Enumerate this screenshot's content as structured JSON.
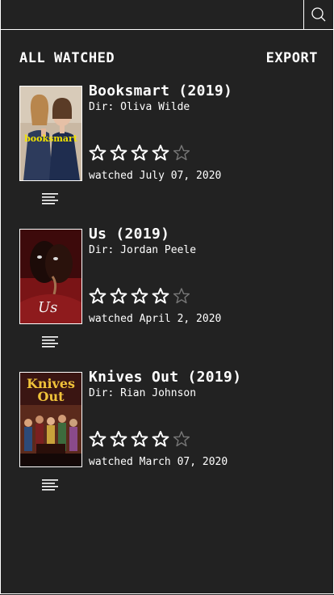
{
  "search": {
    "value": "",
    "placeholder": ""
  },
  "header": {
    "title": "ALL WATCHED",
    "export_label": "EXPORT"
  },
  "colors": {
    "background": "#222222",
    "foreground": "#ffffff",
    "star_empty": "#777777"
  },
  "movies": [
    {
      "title": "Booksmart (2019)",
      "director": "Dir: Oliva Wilde",
      "rating": 4,
      "max_rating": 5,
      "watched": "watched July 07, 2020",
      "poster_text": "booksmart"
    },
    {
      "title": "Us (2019)",
      "director": "Dir: Jordan Peele",
      "rating": 4,
      "max_rating": 5,
      "watched": "watched April 2, 2020",
      "poster_text": "Us"
    },
    {
      "title": "Knives Out (2019)",
      "director": "Dir: Rian Johnson",
      "rating": 4,
      "max_rating": 5,
      "watched": "watched March 07, 2020",
      "poster_text": "Knives Out"
    }
  ]
}
